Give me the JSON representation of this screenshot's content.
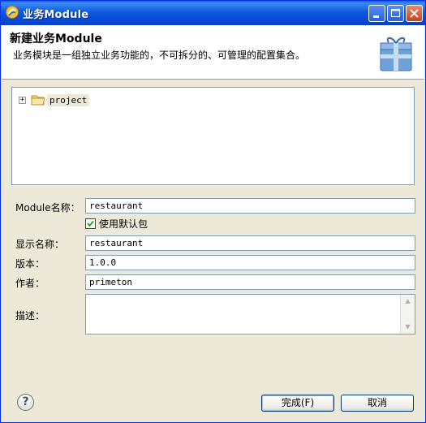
{
  "window": {
    "title": "业务Module"
  },
  "header": {
    "title": "新建业务Module",
    "description": "业务模块是一组独立业务功能的，不可拆分的、可管理的配置集合。"
  },
  "tree": {
    "items": [
      {
        "label": "project",
        "expander": "+"
      }
    ]
  },
  "form": {
    "module_name_label": "Module名称：",
    "module_name_value": "restaurant",
    "use_default_package_label": "使用默认包",
    "use_default_package_checked": true,
    "display_name_label": "显示名称：",
    "display_name_value": "restaurant",
    "version_label": "版本：",
    "version_value": "1.0.0",
    "author_label": "作者：",
    "author_value": "primeton",
    "description_label": "描述：",
    "description_value": ""
  },
  "footer": {
    "help_glyph": "?",
    "finish_label": "完成(F)",
    "cancel_label": "取消"
  },
  "colors": {
    "titlebar": "#0a5de8",
    "dialog_bg": "#ece9d8",
    "field_border": "#7f9db9"
  }
}
